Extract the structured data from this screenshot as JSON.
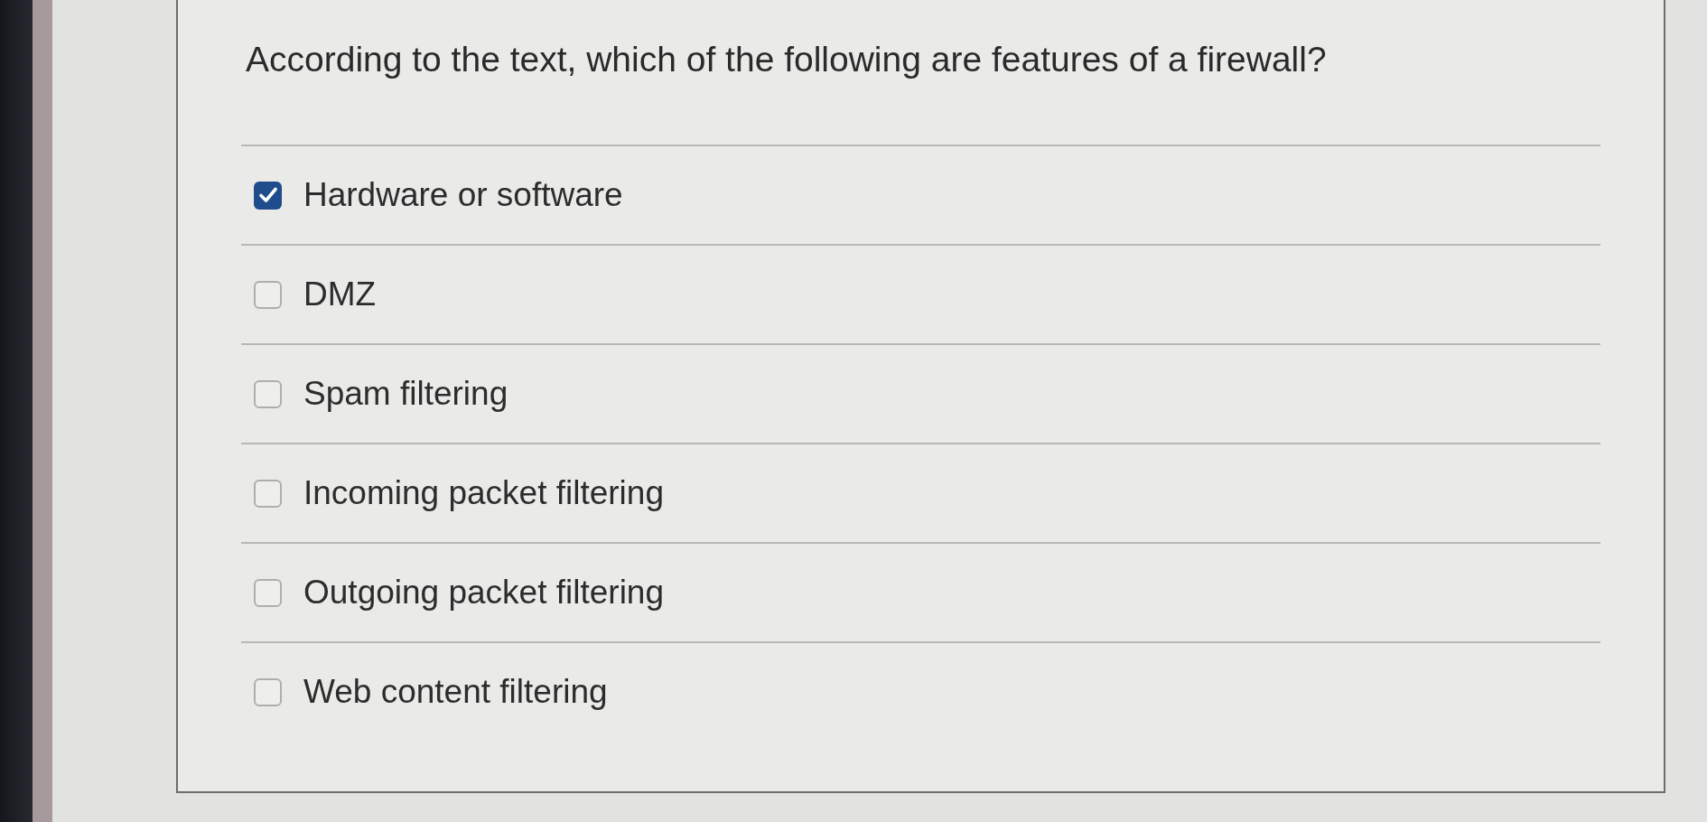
{
  "question": {
    "text": "According to the text, which of the following are features of a firewall?"
  },
  "options": [
    {
      "label": "Hardware or software",
      "checked": true
    },
    {
      "label": "DMZ",
      "checked": false
    },
    {
      "label": "Spam filtering",
      "checked": false
    },
    {
      "label": "Incoming packet filtering",
      "checked": false
    },
    {
      "label": "Outgoing packet filtering",
      "checked": false
    },
    {
      "label": "Web content filtering",
      "checked": false
    }
  ]
}
